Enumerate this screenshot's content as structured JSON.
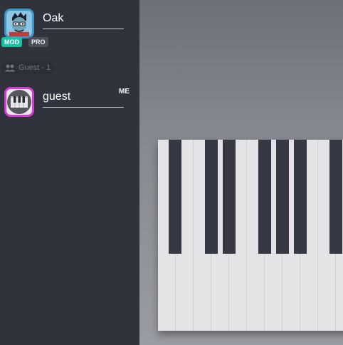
{
  "users": {
    "mod_user": {
      "name": "Oak",
      "badges": [
        "MOD",
        "PRO"
      ]
    },
    "group": {
      "label": "Guest - 1"
    },
    "self_user": {
      "name": "guest",
      "tag": "ME"
    }
  },
  "colors": {
    "mod_badge": "#17c3a4",
    "self_avatar_border": "#d63ad6",
    "mod_avatar_border": "#3b95c8",
    "black_key": "#363944"
  },
  "piano": {
    "white_keys_visible": 11,
    "black_keys_visible": 6
  }
}
